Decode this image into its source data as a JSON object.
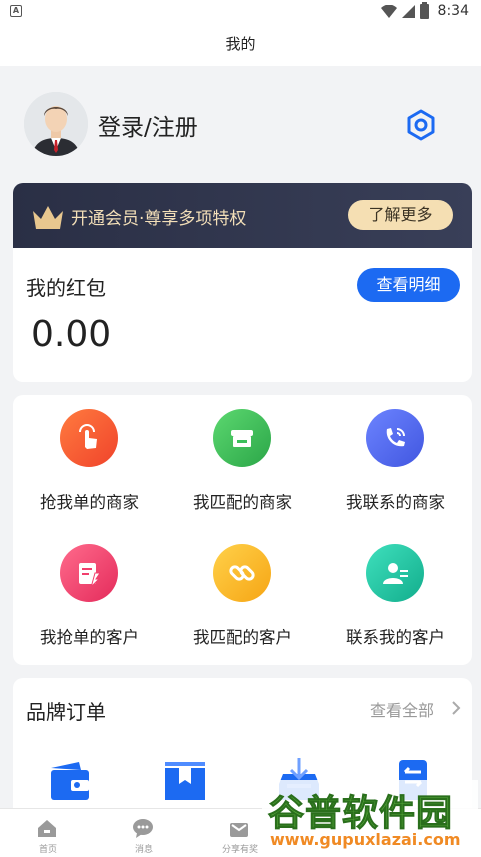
{
  "status_bar": {
    "app_badge": "A",
    "time": "8:34"
  },
  "header": {
    "title": "我的"
  },
  "profile": {
    "login_label": "登录/注册"
  },
  "vip": {
    "text": "开通会员·尊享多项特权",
    "button_label": "了解更多"
  },
  "wallet": {
    "title": "我的红包",
    "detail_button": "查看明细",
    "amount": "0.00"
  },
  "grid": {
    "items": [
      {
        "label": "抢我单的商家",
        "icon": "hand-tap-icon",
        "color": "#f45a33"
      },
      {
        "label": "我匹配的商家",
        "icon": "store-icon",
        "color": "#3cbf5b"
      },
      {
        "label": "我联系的商家",
        "icon": "phone-icon",
        "color": "#4e66ee"
      },
      {
        "label": "我抢单的客户",
        "icon": "note-edit-icon",
        "color": "#f13f6d"
      },
      {
        "label": "我匹配的客户",
        "icon": "link-icon",
        "color": "#f9b626"
      },
      {
        "label": "联系我的客户",
        "icon": "contacts-icon",
        "color": "#1cc4a4"
      }
    ]
  },
  "brand_orders": {
    "title": "品牌订单",
    "view_all": "查看全部",
    "icons": [
      "wallet-icon",
      "bookmark-icon",
      "download-box-icon",
      "refund-icon"
    ]
  },
  "tabbar": {
    "items": [
      {
        "label": "首页",
        "icon": "home-icon"
      },
      {
        "label": "消息",
        "icon": "message-icon"
      },
      {
        "label": "分享有奖",
        "icon": "gift-icon"
      },
      {
        "label": "",
        "icon": "hidden-tab-icon"
      },
      {
        "label": "",
        "icon": "hidden-tab-icon"
      }
    ]
  },
  "watermark": {
    "brand": "谷普软件园",
    "url": "www.gupuxlazai.com"
  },
  "colors": {
    "accent_blue": "#1c6af2",
    "vip_gold": "#f5dfb3",
    "vip_dark": "#2a2f45"
  }
}
